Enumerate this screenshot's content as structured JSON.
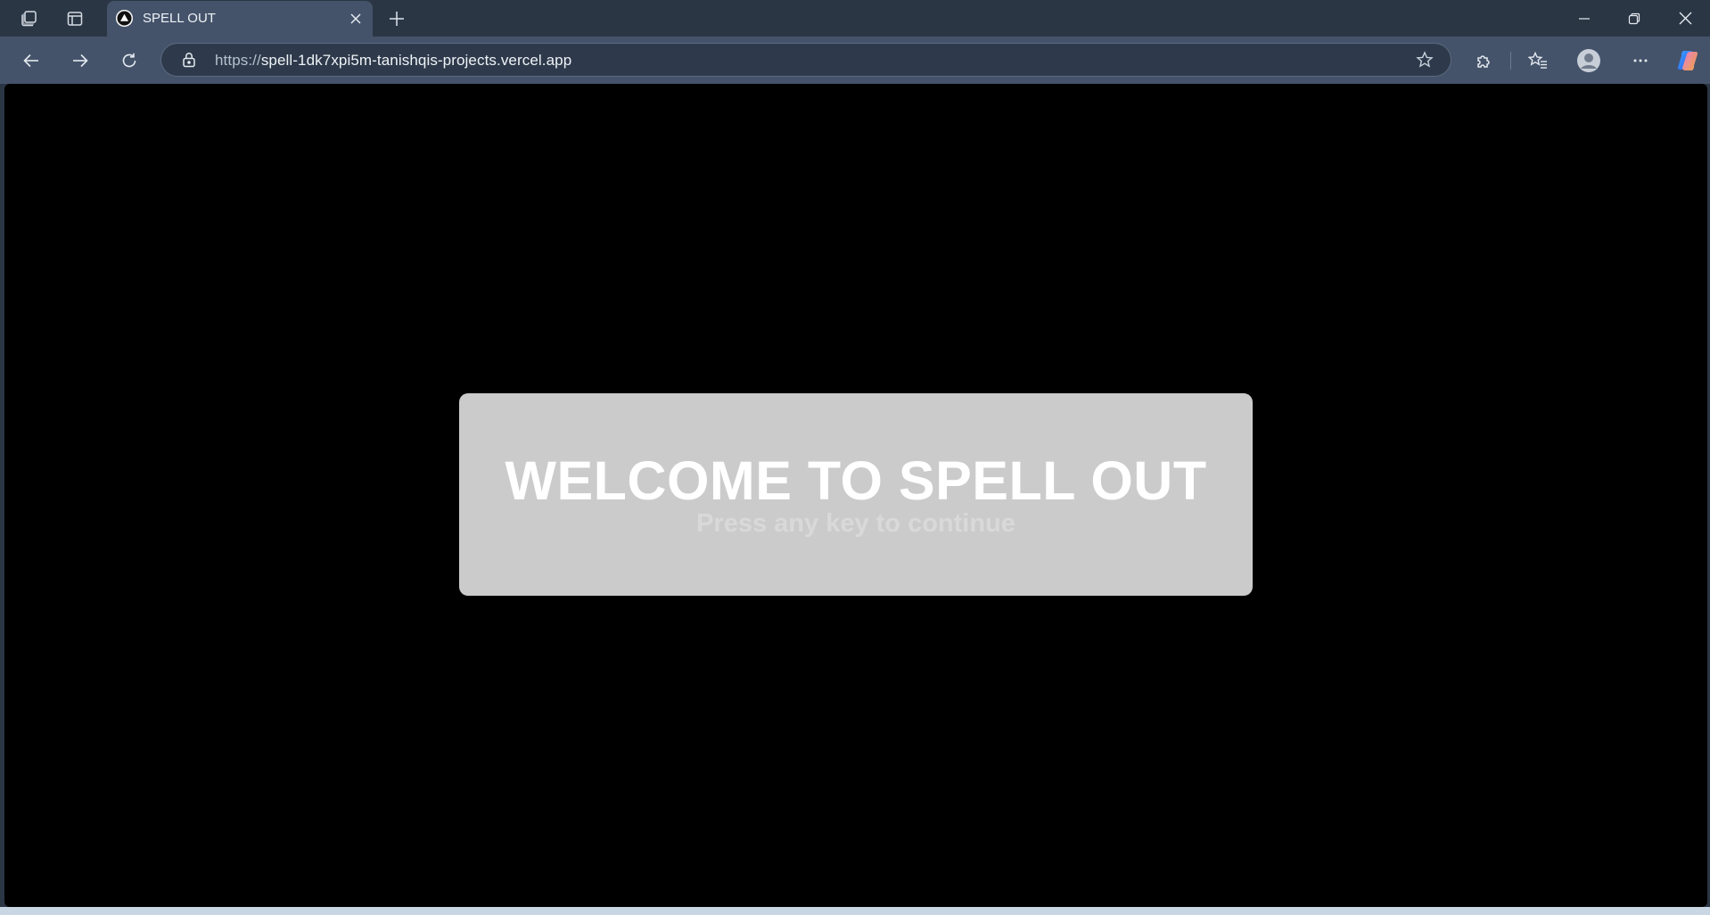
{
  "browser": {
    "tab": {
      "title": "SPELL OUT",
      "favicon": "vercel-triangle-icon"
    },
    "url": {
      "scheme": "https://",
      "host": "spell-1dk7xpi5m-tanishqis-projects.vercel.app"
    },
    "icons": {
      "workspaces": "workspaces-icon",
      "tab_actions": "tab-actions-icon",
      "new_tab": "plus-icon",
      "minimize": "minimize-icon",
      "restore": "restore-icon",
      "close": "close-icon",
      "back": "back-arrow-icon",
      "forward": "forward-arrow-icon",
      "refresh": "refresh-icon",
      "lock": "lock-icon",
      "favorite": "star-icon",
      "extensions": "puzzle-icon",
      "favorites": "favorites-icon",
      "profile": "profile-avatar-icon",
      "more": "more-icon",
      "copilot": "copilot-icon"
    },
    "colors": {
      "frame": "#2b3645",
      "active_tab": "#44536a",
      "page_background": "#000000"
    }
  },
  "page": {
    "title": "WELCOME TO SPELL OUT",
    "subtitle": "Press any key to continue",
    "colors": {
      "card": "#cbcbcb",
      "title": "#ffffff",
      "subtitle": "#d9d9d9"
    }
  }
}
